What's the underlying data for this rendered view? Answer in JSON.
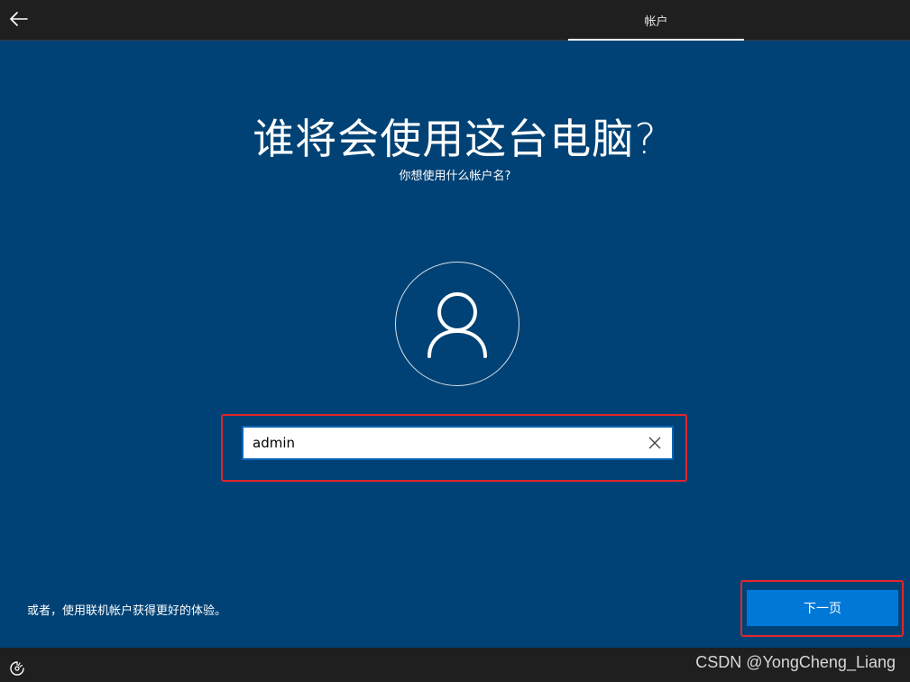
{
  "header": {
    "active_tab": "帐户"
  },
  "main": {
    "title": "谁将会使用这台电脑?",
    "subtitle": "你想使用什么帐户名?",
    "username_value": "admin",
    "alt_link": "或者，使用联机帐户获得更好的体验。",
    "next_button": "下一页"
  },
  "footer": {
    "watermark": "CSDN @YongCheng_Liang"
  },
  "icons": {
    "back": "arrow-left-icon",
    "avatar": "user-icon",
    "clear": "close-icon",
    "accessibility": "ease-of-access-icon"
  },
  "colors": {
    "background": "#004275",
    "bar": "#1f1f1f",
    "accent": "#0078d7",
    "highlight": "#e0262a"
  }
}
